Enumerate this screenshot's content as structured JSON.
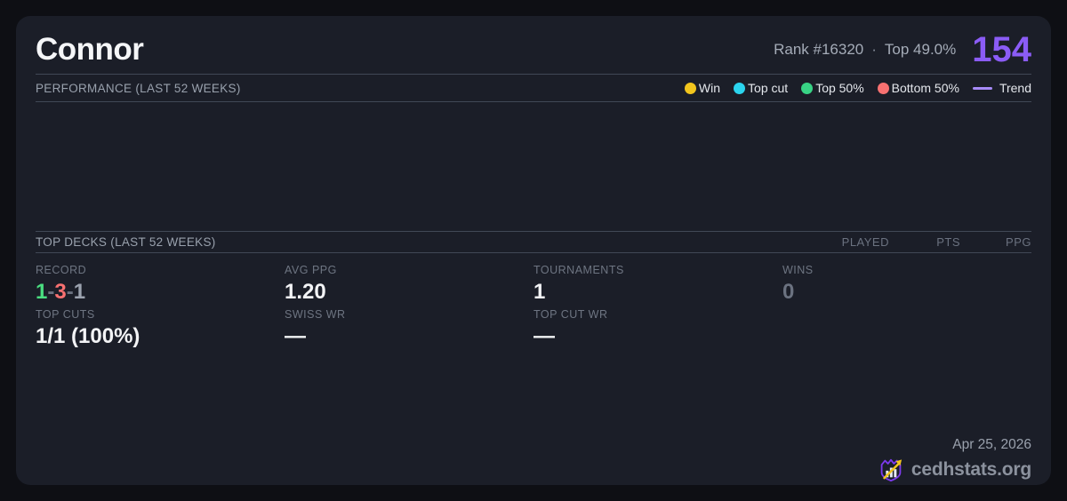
{
  "header": {
    "player_name": "Connor",
    "rank": "Rank #16320",
    "rank_separator": "·",
    "percentile": "Top 49.0%",
    "rating": "154"
  },
  "performance": {
    "title": "PERFORMANCE (LAST 52 WEEKS)",
    "legend": {
      "items": [
        {
          "label": "Win",
          "color": "#f2c51d",
          "marker": "dot"
        },
        {
          "label": "Top cut",
          "color": "#2bd4ee",
          "marker": "dot"
        },
        {
          "label": "Top 50%",
          "color": "#38d385",
          "marker": "dot"
        },
        {
          "label": "Bottom 50%",
          "color": "#f87171",
          "marker": "dot"
        },
        {
          "label": "Trend",
          "color": "#a78bfa",
          "marker": "line"
        }
      ]
    }
  },
  "chart_data": {
    "type": "scatter",
    "title": "PERFORMANCE (LAST 52 WEEKS)",
    "x": [],
    "series": [],
    "legend_position": "top-right",
    "grid": false
  },
  "top_decks": {
    "title": "TOP DECKS (LAST 52 WEEKS)",
    "columns": [
      "PLAYED",
      "PTS",
      "PPG"
    ],
    "rows": []
  },
  "stats": {
    "record": {
      "label": "RECORD",
      "win": "1",
      "loss": "3",
      "draw": "1",
      "separator": "-"
    },
    "avg_ppg": {
      "label": "AVG PPG",
      "value": "1.20"
    },
    "tournaments": {
      "label": "TOURNAMENTS",
      "value": "1"
    },
    "wins": {
      "label": "WINS",
      "value": "0"
    },
    "top_cuts": {
      "label": "TOP CUTS",
      "value": "1/1 (100%)"
    },
    "swiss_wr": {
      "label": "SWISS WR",
      "value": "—"
    },
    "top_cut_wr": {
      "label": "TOP CUT WR",
      "value": "—"
    }
  },
  "footer": {
    "date": "Apr 25, 2026",
    "brand": "cedhstats.org"
  },
  "colors": {
    "page_background": "#0e0f14",
    "card_background": "#1b1e28",
    "divider": "#414856",
    "accent_purple": "#8b5cf6",
    "trend_purple": "#a78bfa",
    "win_yellow": "#f2c51d",
    "top_cut_cyan": "#2bd4ee",
    "top50_green": "#38d385",
    "bottom50_red": "#f87171",
    "record_win_green": "#4ade80",
    "record_loss_red": "#f87171",
    "record_draw_gray": "#9ca3af",
    "muted_gray": "#6b7280",
    "logo_purple": "#7c3aed",
    "logo_gold": "#f2c51d"
  }
}
